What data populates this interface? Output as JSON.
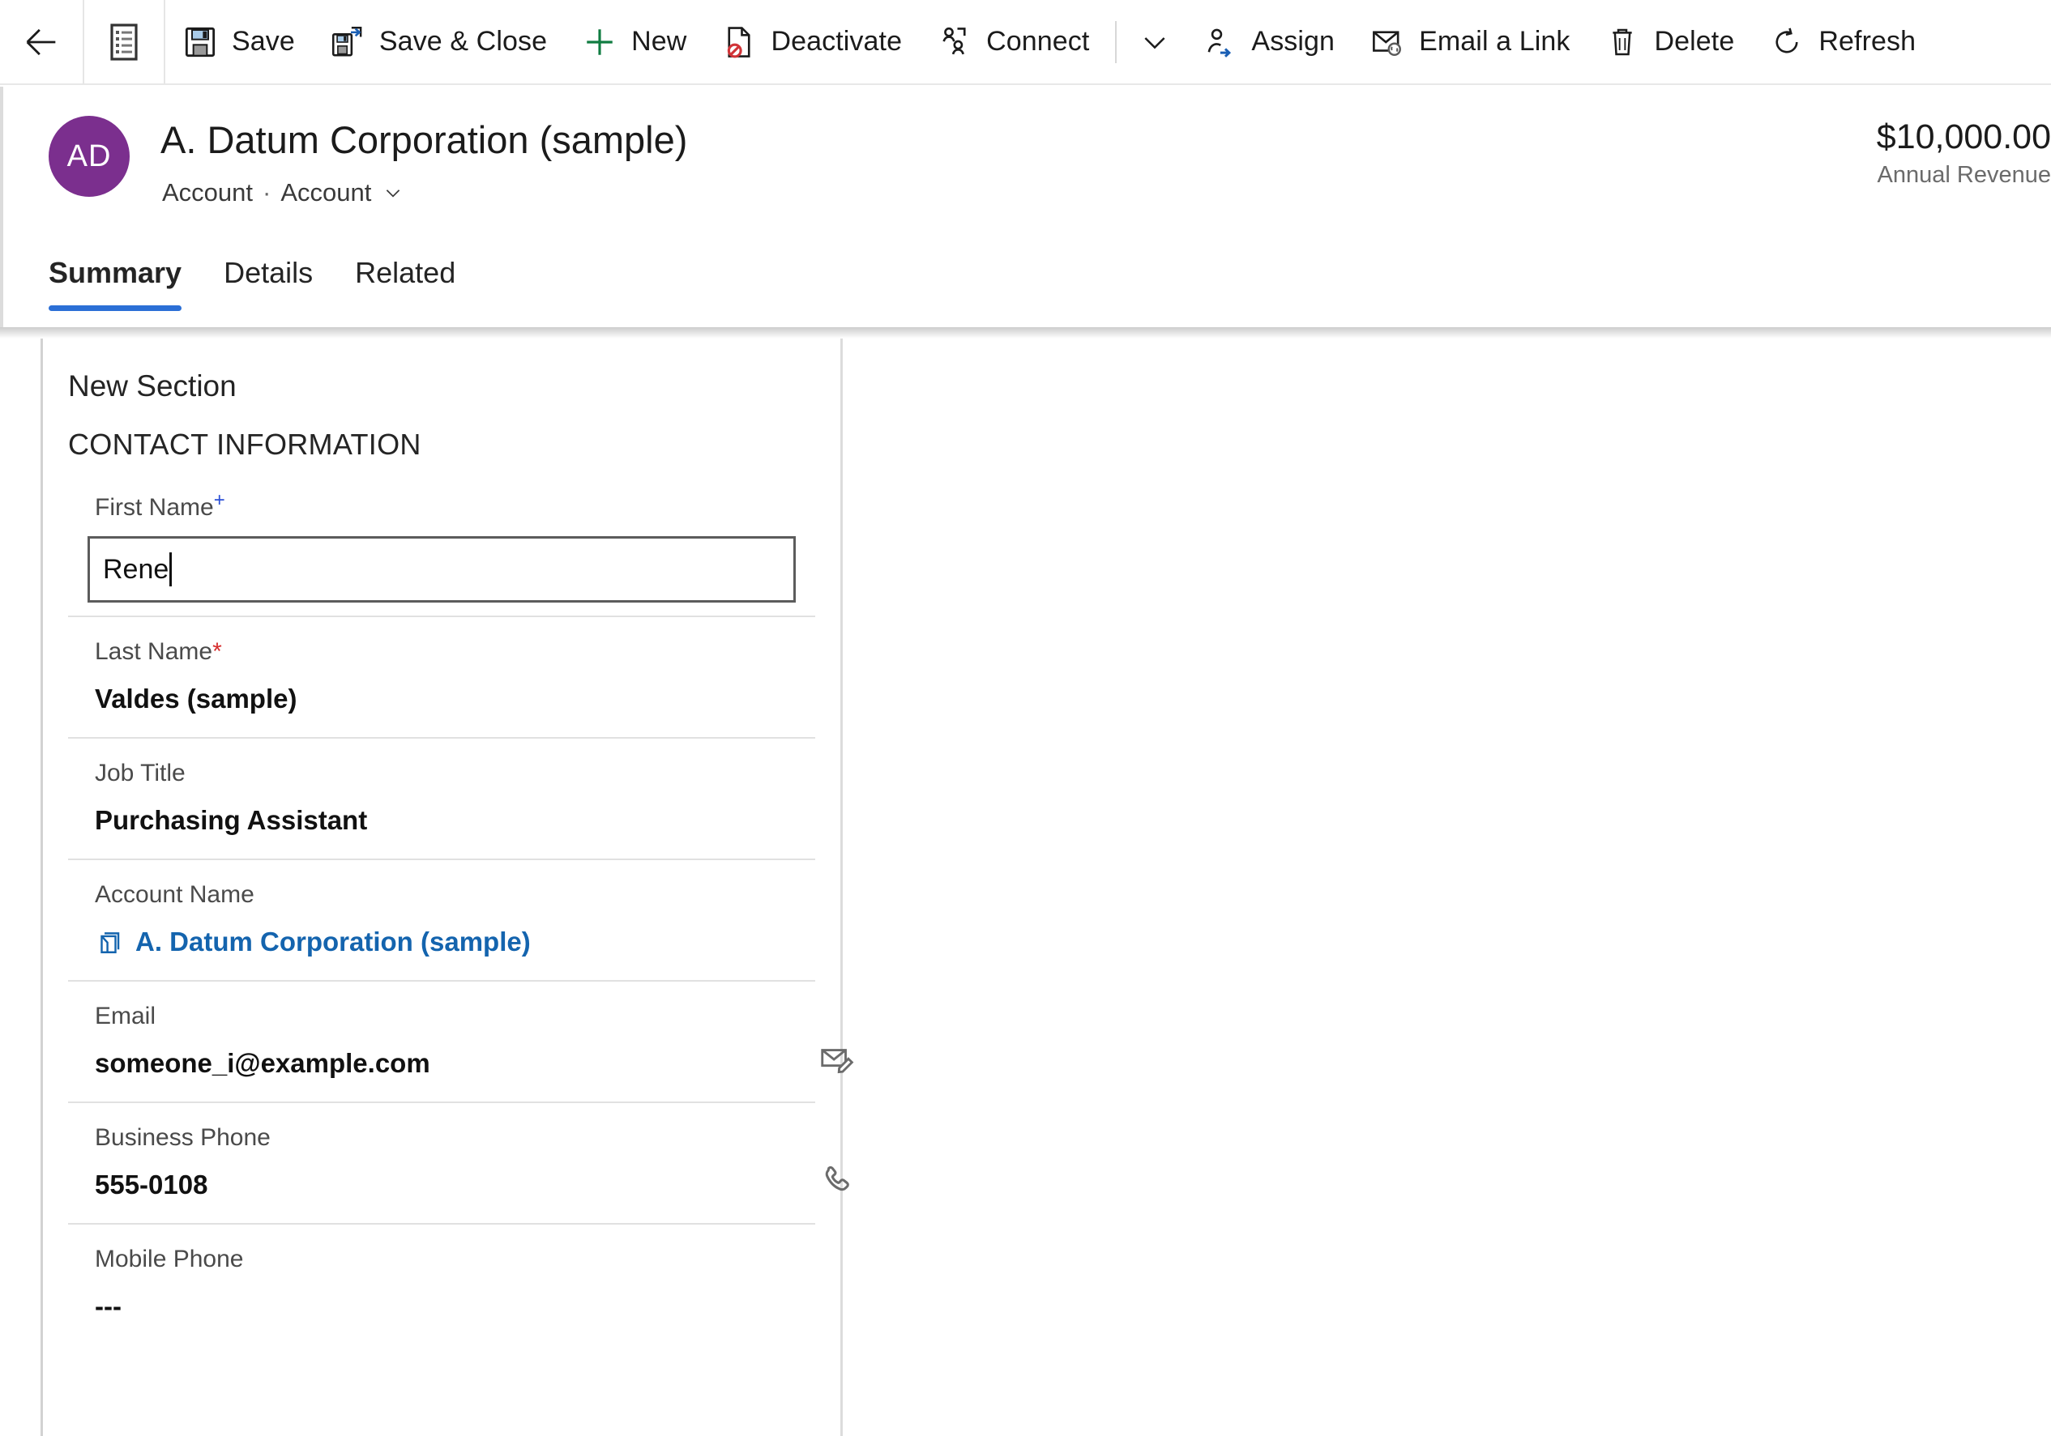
{
  "commandbar": {
    "back": "back-arrow",
    "list": "form-list-icon",
    "items": [
      {
        "icon": "save-icon",
        "label": "Save"
      },
      {
        "icon": "save-close-icon",
        "label": "Save & Close"
      },
      {
        "icon": "new-plus-icon",
        "label": "New"
      },
      {
        "icon": "deactivate-icon",
        "label": "Deactivate"
      },
      {
        "icon": "connect-icon",
        "label": "Connect"
      }
    ],
    "overflow": "chevron-down-icon",
    "items2": [
      {
        "icon": "assign-icon",
        "label": "Assign"
      },
      {
        "icon": "email-link-icon",
        "label": "Email a Link"
      },
      {
        "icon": "delete-icon",
        "label": "Delete"
      },
      {
        "icon": "refresh-icon",
        "label": "Refresh"
      }
    ]
  },
  "record": {
    "avatar_initials": "AD",
    "avatar_color": "#7b2f8e",
    "title": "A. Datum Corporation (sample)",
    "entity_label": "Account",
    "separator": "·",
    "form_name": "Account",
    "revenue_value": "$10,000.00",
    "revenue_caption": "Annual Revenue"
  },
  "tabs": [
    {
      "label": "Summary",
      "active": true
    },
    {
      "label": "Details",
      "active": false
    },
    {
      "label": "Related",
      "active": false
    }
  ],
  "form": {
    "section_title": "New Section",
    "section_subtitle": "CONTACT INFORMATION",
    "fields": {
      "first_name": {
        "label": "First Name",
        "marker": "+",
        "value": "Rene"
      },
      "last_name": {
        "label": "Last Name",
        "marker": "*",
        "value": "Valdes (sample)"
      },
      "job_title": {
        "label": "Job Title",
        "value": "Purchasing Assistant"
      },
      "account_name": {
        "label": "Account Name",
        "value": "A. Datum Corporation (sample)",
        "icon": "account-lookup-icon"
      },
      "email": {
        "label": "Email",
        "value": "someone_i@example.com",
        "action_icon": "compose-email-icon"
      },
      "business_phone": {
        "label": "Business Phone",
        "value": "555-0108",
        "action_icon": "phone-call-icon"
      },
      "mobile_phone": {
        "label": "Mobile Phone",
        "value": "---"
      }
    }
  },
  "colors": {
    "accent": "#2b6fd6",
    "link": "#1464ae",
    "required": "#d62e2e",
    "recommended": "#2b4fd6"
  }
}
